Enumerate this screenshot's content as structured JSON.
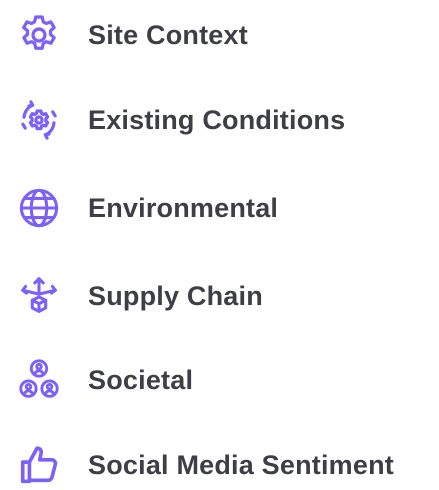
{
  "colors": {
    "icon": "#7b61f8",
    "text": "#3d3e46",
    "background": "#ffffff"
  },
  "menu": {
    "items": [
      {
        "label": "Site Context",
        "icon": "gear-icon"
      },
      {
        "label": "Existing Conditions",
        "icon": "gear-cycle-icon"
      },
      {
        "label": "Environmental",
        "icon": "globe-icon"
      },
      {
        "label": "Supply Chain",
        "icon": "supply-chain-icon"
      },
      {
        "label": "Societal",
        "icon": "people-network-icon"
      },
      {
        "label": "Social Media Sentiment",
        "icon": "thumbs-up-icon"
      }
    ]
  }
}
